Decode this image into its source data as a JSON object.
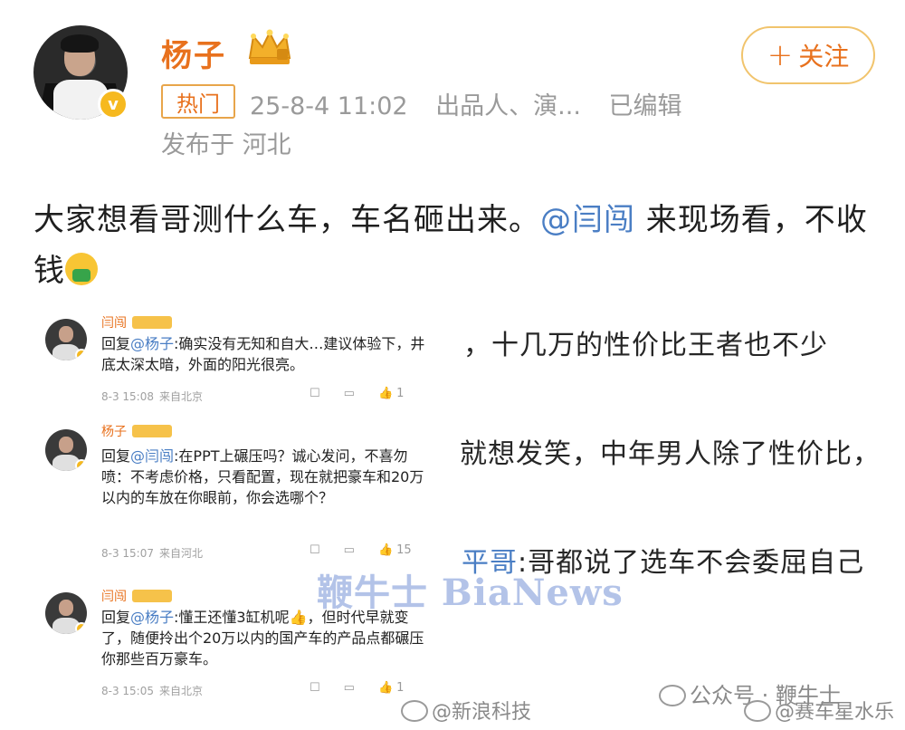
{
  "header": {
    "user_name": "杨子",
    "follow_label": "关注",
    "follow_plus": "+",
    "hot_badge": "热门",
    "date": "25-8-4 11:02",
    "role": "出品人、演...",
    "edited": "已编辑",
    "location": "发布于 河北"
  },
  "post": {
    "text_part1": "大家想看哥测什么车，车名砸出来。",
    "mention": "@闫闯",
    "text_part2": " 来现场看，不收钱"
  },
  "background_lines": {
    "line1": "，十几万的性价比王者也不少",
    "line2": "就想发笑，中年男人除了性价比，",
    "line3_name": "平哥",
    "line3_text": ":哥都说了选车不会委屈自己"
  },
  "comments": [
    {
      "name": "闫闯",
      "reply_prefix": "回复",
      "reply_target": "@杨子",
      "text": ":确实没有无知和自大…建议体验下，井底太深太暗，外面的阳光很亮。",
      "date": "8-3 15:08",
      "source": "来自北京",
      "likes": "1"
    },
    {
      "name": "杨子",
      "reply_prefix": "回复",
      "reply_target": "@闫闯",
      "text": ":在PPT上碾压吗？诚心发问，不喜勿喷：不考虑价格，只看配置，现在就把豪车和20万以内的车放在你眼前，你会选哪个？",
      "date": "8-3 15:07",
      "source": "来自河北",
      "likes": "15"
    },
    {
      "name": "闫闯",
      "reply_prefix": "回复",
      "reply_target": "@杨子",
      "text": ":懂王还懂3缸机呢👍，但时代早就变了，随便拎出个20万以内的国产车的产品点都碾压你那些百万豪车。",
      "date": "8-3 15:05",
      "source": "来自北京",
      "likes": "1"
    }
  ],
  "watermarks": {
    "center": "鞭牛士 BiaNews",
    "wechat": "公众号 · 鞭牛士",
    "weibo1": "@新浪科技",
    "weibo2": "@赛车星水乐"
  },
  "icons": {
    "verify": "verified-badge-icon",
    "crown": "crown-icon",
    "edit": "edit-icon",
    "comment": "comment-icon",
    "like": "thumbs-up-icon"
  },
  "colors": {
    "accent_orange": "#e8711d",
    "mention_blue": "#4a7ec4",
    "meta_gray": "#9a9a9a",
    "gold": "#f6b91f"
  }
}
